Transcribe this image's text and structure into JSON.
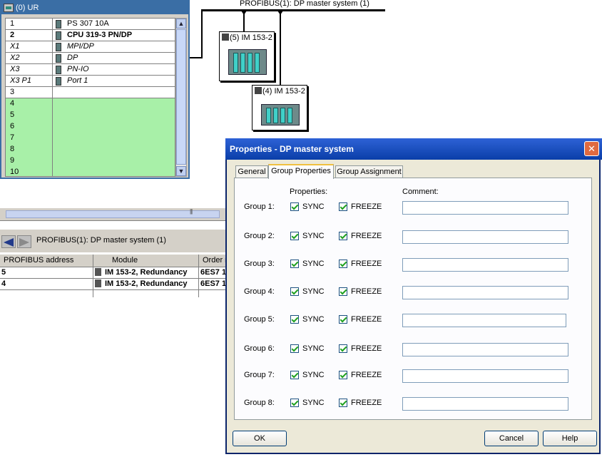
{
  "rack": {
    "title": "(0) UR",
    "rows": [
      {
        "slot": "1",
        "module": "PS 307 10A",
        "style": "normal",
        "icon": "module-icon",
        "empty": false
      },
      {
        "slot": "2",
        "module": "CPU 319-3 PN/DP",
        "style": "bold",
        "icon": "module-icon",
        "empty": false
      },
      {
        "slot": "X1",
        "module": "MPI/DP",
        "style": "italic",
        "icon": "module-icon",
        "empty": false
      },
      {
        "slot": "X2",
        "module": "DP",
        "style": "italic",
        "icon": "module-icon",
        "empty": false
      },
      {
        "slot": "X3",
        "module": "PN-IO",
        "style": "italic",
        "icon": "module-icon",
        "empty": false
      },
      {
        "slot": "X3 P1",
        "module": "Port 1",
        "style": "italic",
        "icon": "module-icon",
        "empty": false
      },
      {
        "slot": "3",
        "module": "",
        "style": "normal",
        "empty": true
      },
      {
        "slot": "4",
        "module": "",
        "style": "normal",
        "empty": true
      },
      {
        "slot": "5",
        "module": "",
        "style": "normal",
        "empty": true
      },
      {
        "slot": "6",
        "module": "",
        "style": "normal",
        "empty": true
      },
      {
        "slot": "7",
        "module": "",
        "style": "normal",
        "empty": true
      },
      {
        "slot": "8",
        "module": "",
        "style": "normal",
        "empty": true
      },
      {
        "slot": "9",
        "module": "",
        "style": "normal",
        "empty": true
      },
      {
        "slot": "10",
        "module": "",
        "style": "normal",
        "empty": true
      }
    ],
    "empty_slot_color": "#a8f0a8"
  },
  "network": {
    "bus_label": "PROFIBUS(1): DP master system (1)",
    "slaves": [
      {
        "label": "(5) IM 153-2"
      },
      {
        "label": "(4) IM 153-2"
      }
    ]
  },
  "detail": {
    "caption": "PROFIBUS(1): DP master system (1)",
    "columns": [
      "PROFIBUS address",
      "Module",
      "Order n"
    ],
    "rows": [
      {
        "address": "5",
        "module": "IM 153-2, Redundancy",
        "order": "6ES7 1"
      },
      {
        "address": "4",
        "module": "IM 153-2, Redundancy",
        "order": "6ES7 1"
      }
    ]
  },
  "dialog": {
    "title": "Properties - DP master system",
    "close_label": "✕",
    "tabs": [
      {
        "label": "General",
        "active": false
      },
      {
        "label": "Group Properties",
        "active": true
      },
      {
        "label": "Group Assignment",
        "active": false
      }
    ],
    "properties_header": "Properties:",
    "comment_header": "Comment:",
    "sync_label": "SYNC",
    "freeze_label": "FREEZE",
    "groups": [
      {
        "label": "Group 1:",
        "sync": true,
        "freeze": true,
        "comment": ""
      },
      {
        "label": "Group 2:",
        "sync": true,
        "freeze": true,
        "comment": ""
      },
      {
        "label": "Group 3:",
        "sync": true,
        "freeze": true,
        "comment": ""
      },
      {
        "label": "Group 4:",
        "sync": true,
        "freeze": true,
        "comment": ""
      },
      {
        "label": "Group 5:",
        "sync": true,
        "freeze": true,
        "comment": ""
      },
      {
        "label": "Group 6:",
        "sync": true,
        "freeze": true,
        "comment": ""
      },
      {
        "label": "Group 7:",
        "sync": true,
        "freeze": true,
        "comment": ""
      },
      {
        "label": "Group 8:",
        "sync": true,
        "freeze": true,
        "comment": ""
      }
    ],
    "ok_label": "OK",
    "cancel_label": "Cancel",
    "help_label": "Help"
  },
  "colors": {
    "titlebar": "#0a3ea8",
    "rack_title": "#3a6ea5",
    "empty_slot": "#a8f0a8",
    "check": "#21a121"
  }
}
